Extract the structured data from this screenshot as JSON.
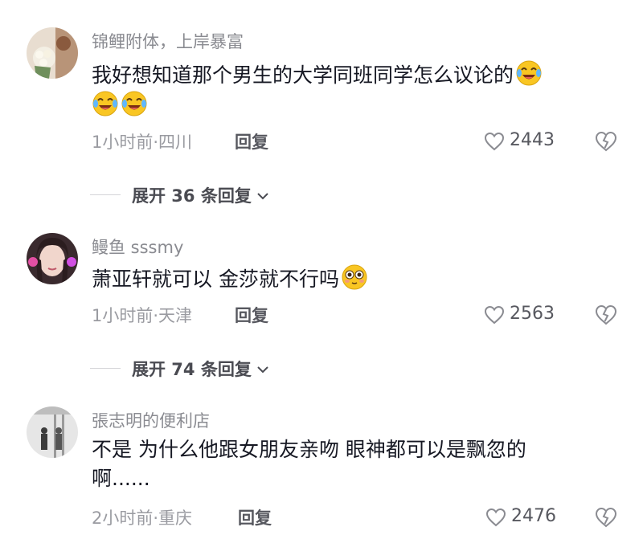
{
  "comments": [
    {
      "username": "锦鲤附体，上岸暴富",
      "text_line1": "我好想知道那个男生的大学同班同学怎么议论的",
      "text_line2": "",
      "emoji": "laugh-cry-emoji",
      "time": "1小时前·四川",
      "reply": "回复",
      "likes": "2443",
      "expand": "展开 36 条回复"
    },
    {
      "username": "鳗鱼 sssmy",
      "text_line1": "萧亚轩就可以 金莎就不行吗",
      "text_line2": "",
      "emoji": "shy-emoji",
      "time": "1小时前·天津",
      "reply": "回复",
      "likes": "2563",
      "expand": "展开 74 条回复"
    },
    {
      "username": "張志明的便利店",
      "text_line1": "不是 为什么他跟女朋友亲吻 眼神都可以是飘忽的",
      "text_line2": "啊......",
      "time": "2小时前·重庆",
      "reply": "回复",
      "likes": "2476"
    }
  ],
  "icons": {
    "like": "heart-outline-icon",
    "dislike": "broken-heart-icon",
    "chevron": "chevron-down-icon"
  },
  "colors": {
    "username": "#8a8b91",
    "text": "#161823",
    "meta": "#9a9ba1",
    "emoji_yellow": "#f9c623"
  }
}
